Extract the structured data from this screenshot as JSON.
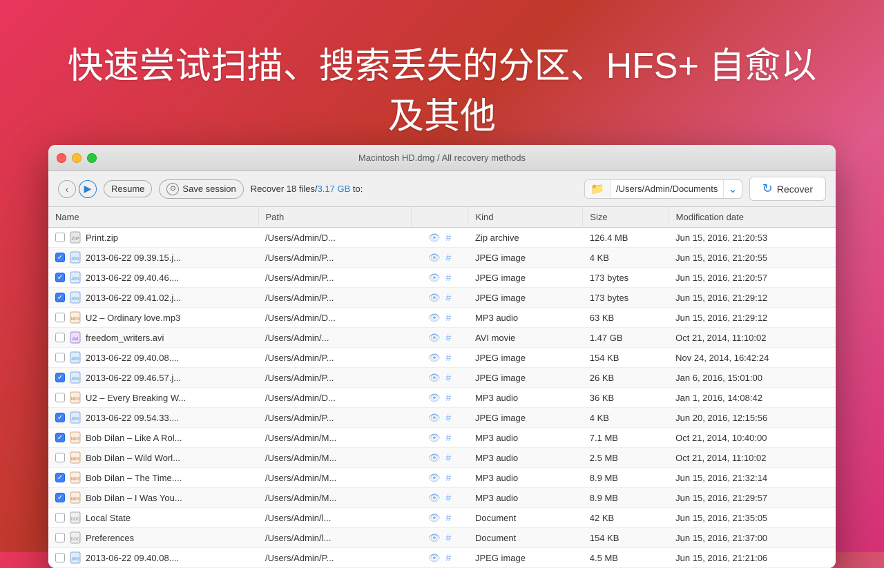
{
  "hero": {
    "title": "快速尝试扫描、搜索丢失的分区、HFS+ 自愈以及其他"
  },
  "window": {
    "title": "Macintosh HD.dmg / All recovery methods",
    "traffic_lights": [
      "close",
      "minimize",
      "maximize"
    ]
  },
  "toolbar": {
    "back_btn": "‹",
    "play_btn": "▶",
    "resume_label": "Resume",
    "save_icon": "⊙",
    "save_label": "Save session",
    "recover_info": "Recover 18 files/",
    "recover_size": "3.17 GB",
    "recover_to": "to:",
    "path_icon": "📁",
    "path_text": "/Users/Admin/Documents",
    "recover_button": "Recover"
  },
  "table": {
    "columns": [
      "Name",
      "Path",
      "",
      "Kind",
      "Size",
      "Modification date"
    ],
    "rows": [
      {
        "checked": false,
        "icon": "zip",
        "name": "Print.zip",
        "path": "/Users/Admin/D...",
        "kind": "Zip archive",
        "size": "126.4 MB",
        "date": "Jun 15, 2016, 21:20:53"
      },
      {
        "checked": true,
        "icon": "jpg",
        "name": "2013-06-22 09.39.15.j...",
        "path": "/Users/Admin/P...",
        "kind": "JPEG image",
        "size": "4 KB",
        "date": "Jun 15, 2016, 21:20:55"
      },
      {
        "checked": true,
        "icon": "jpg",
        "name": "2013-06-22 09.40.46....",
        "path": "/Users/Admin/P...",
        "kind": "JPEG image",
        "size": "173 bytes",
        "date": "Jun 15, 2016, 21:20:57"
      },
      {
        "checked": true,
        "icon": "jpg",
        "name": "2013-06-22 09.41.02.j...",
        "path": "/Users/Admin/P...",
        "kind": "JPEG image",
        "size": "173 bytes",
        "date": "Jun 15, 2016, 21:29:12"
      },
      {
        "checked": false,
        "icon": "mp3",
        "name": "U2 – Ordinary love.mp3",
        "path": "/Users/Admin/D...",
        "kind": "MP3 audio",
        "size": "63 KB",
        "date": "Jun 15, 2016, 21:29:12"
      },
      {
        "checked": false,
        "icon": "avi",
        "name": "freedom_writers.avi",
        "path": "/Users/Admin/...",
        "kind": "AVI movie",
        "size": "1.47 GB",
        "date": "Oct 21, 2014, 11:10:02"
      },
      {
        "checked": false,
        "icon": "jpg",
        "name": "2013-06-22 09.40.08....",
        "path": "/Users/Admin/P...",
        "kind": "JPEG image",
        "size": "154 KB",
        "date": "Nov 24, 2014, 16:42:24"
      },
      {
        "checked": true,
        "icon": "jpg",
        "name": "2013-06-22 09.46.57.j...",
        "path": "/Users/Admin/P...",
        "kind": "JPEG image",
        "size": "26 KB",
        "date": "Jan 6, 2016, 15:01:00"
      },
      {
        "checked": false,
        "icon": "mp3",
        "name": "U2 – Every Breaking W...",
        "path": "/Users/Admin/D...",
        "kind": "MP3 audio",
        "size": "36 KB",
        "date": "Jan 1, 2016, 14:08:42"
      },
      {
        "checked": true,
        "icon": "jpg",
        "name": "2013-06-22 09.54.33....",
        "path": "/Users/Admin/P...",
        "kind": "JPEG image",
        "size": "4 KB",
        "date": "Jun 20, 2016, 12:15:56"
      },
      {
        "checked": true,
        "icon": "mp3",
        "name": "Bob Dilan – Like A Rol...",
        "path": "/Users/Admin/M...",
        "kind": "MP3 audio",
        "size": "7.1 MB",
        "date": "Oct 21, 2014, 10:40:00"
      },
      {
        "checked": false,
        "icon": "mp3",
        "name": "Bob Dilan – Wild Worl...",
        "path": "/Users/Admin/M...",
        "kind": "MP3 audio",
        "size": "2.5 MB",
        "date": "Oct 21, 2014, 11:10:02"
      },
      {
        "checked": true,
        "icon": "mp3",
        "name": "Bob Dilan – The Time....",
        "path": "/Users/Admin/M...",
        "kind": "MP3 audio",
        "size": "8.9 MB",
        "date": "Jun 15, 2016, 21:32:14"
      },
      {
        "checked": true,
        "icon": "mp3",
        "name": "Bob Dilan – I Was You...",
        "path": "/Users/Admin/M...",
        "kind": "MP3 audio",
        "size": "8.9 MB",
        "date": "Jun 15, 2016, 21:29:57"
      },
      {
        "checked": false,
        "icon": "doc",
        "name": "Local State",
        "path": "/Users/Admin/l...",
        "kind": "Document",
        "size": "42 KB",
        "date": "Jun 15, 2016, 21:35:05"
      },
      {
        "checked": false,
        "icon": "doc",
        "name": "Preferences",
        "path": "/Users/Admin/l...",
        "kind": "Document",
        "size": "154 KB",
        "date": "Jun 15, 2016, 21:37:00"
      },
      {
        "checked": false,
        "icon": "jpg",
        "name": "2013-06-22 09.40.08....",
        "path": "/Users/Admin/P...",
        "kind": "JPEG image",
        "size": "4.5 MB",
        "date": "Jun 15, 2016, 21:21:06"
      }
    ]
  }
}
